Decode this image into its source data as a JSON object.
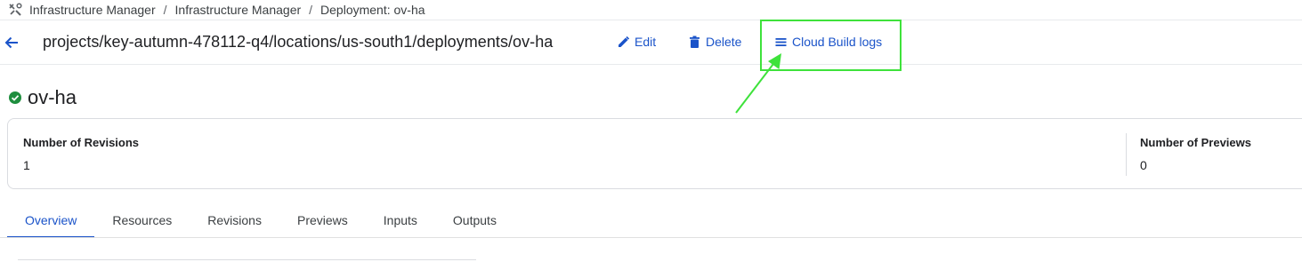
{
  "breadcrumb": {
    "items": [
      "Infrastructure Manager",
      "Infrastructure Manager",
      "Deployment: ov-ha"
    ],
    "separator": "/"
  },
  "header": {
    "path": "projects/key-autumn-478112-q4/locations/us-south1/deployments/ov-ha",
    "actions": {
      "edit": "Edit",
      "delete": "Delete",
      "logs": "Cloud Build logs"
    }
  },
  "deployment": {
    "name": "ov-ha",
    "status": "succeeded"
  },
  "stats": {
    "revisions_label": "Number of Revisions",
    "revisions_value": "1",
    "previews_label": "Number of Previews",
    "previews_value": "0"
  },
  "tabs": [
    "Overview",
    "Resources",
    "Revisions",
    "Previews",
    "Inputs",
    "Outputs"
  ],
  "active_tab": "Overview",
  "colors": {
    "accent": "#1a53c9",
    "success": "#1e8e3e",
    "highlight": "#3ee23b"
  },
  "icons": {
    "breadcrumb": "infrastructure-tools-icon",
    "back": "arrow-back-icon",
    "edit": "pencil-icon",
    "delete": "trash-icon",
    "logs": "list-lines-icon",
    "status": "check-circle-icon"
  }
}
